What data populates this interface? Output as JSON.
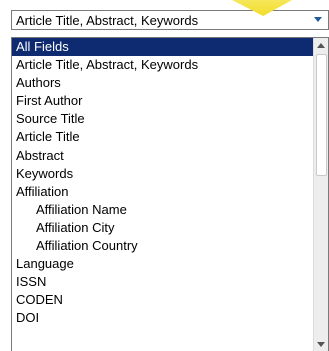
{
  "select": {
    "value": "Article Title, Abstract, Keywords",
    "arrow_icon": "triangle-down",
    "arrow_color": "#1f5a9e"
  },
  "dropdown": {
    "selected_index": 0,
    "selected_bg": "#0e2b72",
    "items": [
      {
        "label": "All Fields",
        "indent": false
      },
      {
        "label": "Article Title, Abstract, Keywords",
        "indent": false
      },
      {
        "label": "Authors",
        "indent": false
      },
      {
        "label": "First Author",
        "indent": false
      },
      {
        "label": "Source Title",
        "indent": false
      },
      {
        "label": "Article Title",
        "indent": false
      },
      {
        "label": "Abstract",
        "indent": false
      },
      {
        "label": "Keywords",
        "indent": false
      },
      {
        "label": "Affiliation",
        "indent": false
      },
      {
        "label": "Affiliation Name",
        "indent": true
      },
      {
        "label": "Affiliation City",
        "indent": true
      },
      {
        "label": "Affiliation Country",
        "indent": true
      },
      {
        "label": "Language",
        "indent": false
      },
      {
        "label": "ISSN",
        "indent": false
      },
      {
        "label": "CODEN",
        "indent": false
      },
      {
        "label": "DOI",
        "indent": false
      }
    ]
  },
  "highlight_color": "#f3dc2c"
}
